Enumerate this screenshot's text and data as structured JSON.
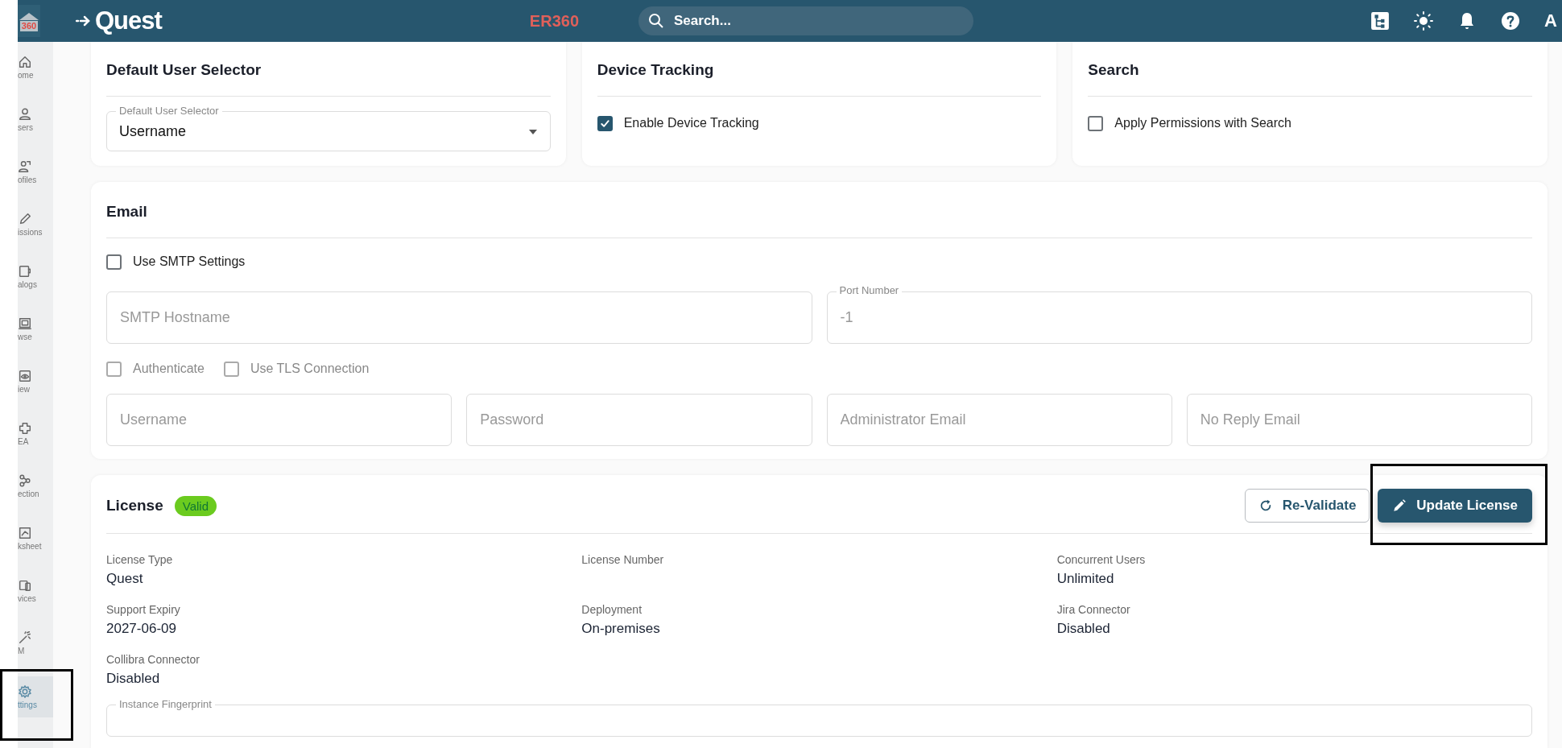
{
  "header": {
    "app_icon": "360",
    "logo": "Quest",
    "product": "ER360",
    "search": {
      "placeholder": "Search..."
    },
    "avatar": "A"
  },
  "sidebar": {
    "items": [
      {
        "label": "ome",
        "selected": false
      },
      {
        "label": "sers",
        "selected": false
      },
      {
        "label": "ofiles",
        "selected": false
      },
      {
        "label": "issions",
        "selected": false
      },
      {
        "label": "alogs",
        "selected": false
      },
      {
        "label": "wse",
        "selected": false
      },
      {
        "label": "iew",
        "selected": false
      },
      {
        "label": "EA",
        "selected": false
      },
      {
        "label": "ection",
        "selected": false
      },
      {
        "label": "ksheet",
        "selected": false
      },
      {
        "label": "vices",
        "selected": false
      },
      {
        "label": "M",
        "selected": false
      },
      {
        "label": "ttings",
        "selected": true
      }
    ]
  },
  "top_cards": [
    {
      "title": "Default User Selector",
      "kind": "select",
      "label": "Default User Selector",
      "value": "Username"
    },
    {
      "title": "Device Tracking",
      "kind": "checkbox",
      "label": "Enable Device Tracking",
      "checked": true
    },
    {
      "title": "Search",
      "kind": "checkbox",
      "label": "Apply Permissions with Search",
      "checked": false
    }
  ],
  "email": {
    "title": "Email",
    "use_smtp": {
      "label": "Use SMTP Settings",
      "checked": false
    },
    "server_fields": [
      {
        "placeholder": "SMTP Hostname"
      },
      {
        "label": "Port Number",
        "placeholder": "-1"
      }
    ],
    "options": [
      {
        "label": "Authenticate",
        "checked": false
      },
      {
        "label": "Use TLS Connection",
        "checked": false
      }
    ],
    "account_fields": [
      {
        "placeholder": "Username"
      },
      {
        "placeholder": "Password"
      },
      {
        "placeholder": "Administrator Email"
      },
      {
        "placeholder": "No Reply Email"
      }
    ]
  },
  "license": {
    "title": "License",
    "status": "Valid",
    "buttons": [
      {
        "label": "Re-Validate",
        "kind": "outline"
      },
      {
        "label": "Update License",
        "kind": "primary"
      }
    ],
    "details": [
      {
        "label": "License Type",
        "value": "Quest"
      },
      {
        "label": "License Number"
      },
      {
        "label": "Concurrent Users",
        "value": "Unlimited"
      },
      {
        "label": "Support Expiry",
        "value": "2027-06-09"
      },
      {
        "label": "Deployment",
        "value": "On-premises"
      },
      {
        "label": "Jira Connector",
        "value": "Disabled"
      },
      {
        "label": "Collibra Connector",
        "value": "Disabled"
      }
    ],
    "fingerprint": {
      "label": "Instance Fingerprint"
    }
  }
}
